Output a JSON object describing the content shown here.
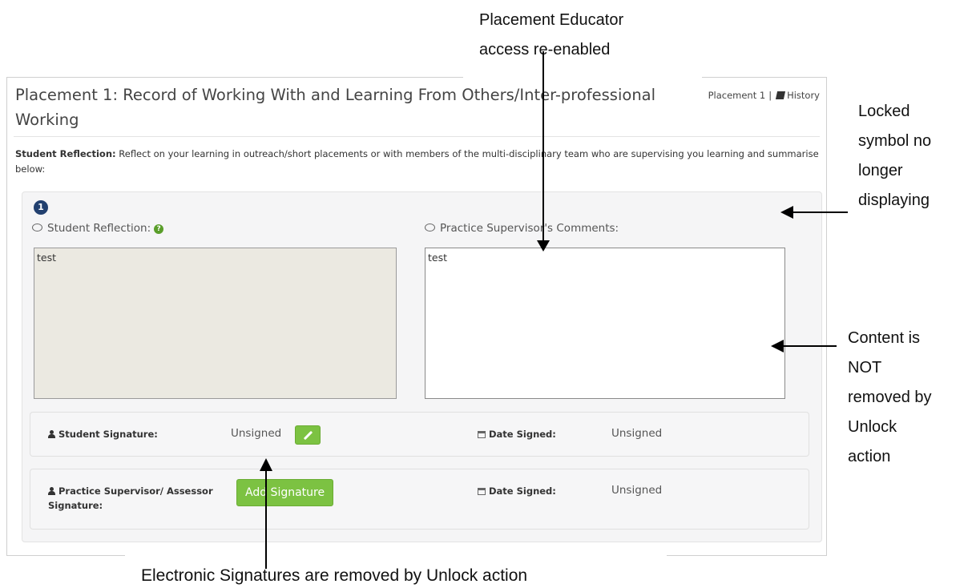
{
  "annotations": {
    "top_line1": "Placement Educator",
    "top_line2": "access re-enabled",
    "right1_lines": [
      "Locked",
      "symbol no",
      "longer",
      "displaying"
    ],
    "right2_lines": [
      "Content is",
      "NOT",
      "removed by",
      "Unlock",
      "action"
    ],
    "bottom": "Electronic Signatures are removed by Unlock action"
  },
  "header": {
    "title": "Placement 1: Record of Working With and Learning From Others/Inter-professional Working",
    "placement_link": "Placement 1",
    "separator": "|",
    "history_link": "History"
  },
  "instructions": {
    "label": "Student Reflection:",
    "text": " Reflect on your learning in outreach/short placements or with members of the multi-disciplinary team who are supervising you learning and summarise below:"
  },
  "entry": {
    "number": "1",
    "student_reflection_label": "Student Reflection:",
    "student_reflection_value": "test",
    "supervisor_comments_label": "Practice Supervisor's Comments:",
    "supervisor_comments_value": "test"
  },
  "signatures": {
    "student_label": "Student Signature:",
    "student_value": "Unsigned",
    "date_label": "Date Signed:",
    "student_date_value": "Unsigned",
    "supervisor_label": "Practice Supervisor/ Assessor Signature:",
    "add_signature_button": "Add Signature",
    "supervisor_date_value": "Unsigned"
  },
  "icons": {
    "history": "book-icon",
    "comment": "speech-bubble-icon",
    "help": "question-circle-icon",
    "person": "user-icon",
    "calendar": "calendar-icon",
    "edit": "pencil-icon"
  },
  "colors": {
    "green_button": "#7cc242",
    "badge": "#22406f",
    "readonly_textarea": "#ebe9e1"
  }
}
